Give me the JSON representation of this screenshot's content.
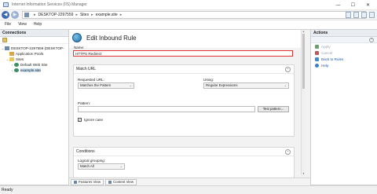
{
  "window": {
    "title": "Internet Information Services (IIS) Manager"
  },
  "address": {
    "crumbs": [
      "DESKTOP-2297559",
      "Sites",
      "example.site"
    ]
  },
  "menu": {
    "items": [
      "File",
      "View",
      "Help"
    ]
  },
  "connections": {
    "header": "Connections",
    "tree": [
      {
        "label": "DESKTOP-2297559 (DESKTOP-",
        "toggle": "⌄",
        "icon": "server"
      },
      {
        "label": "Application Pools",
        "toggle": "",
        "icon": "pool"
      },
      {
        "label": "Sites",
        "toggle": "⌄",
        "icon": "folder"
      },
      {
        "label": "Default Web Site",
        "toggle": "›",
        "icon": "globe"
      },
      {
        "label": "example.site",
        "toggle": "›",
        "icon": "globe"
      }
    ]
  },
  "main": {
    "title": "Edit Inbound Rule",
    "name_label": "Name:",
    "name_value": "HTTPS Redirect",
    "match_url": {
      "header": "Match URL",
      "requested_url_label": "Requested URL:",
      "requested_url_value": "Matches the Pattern",
      "using_label": "Using:",
      "using_value": "Regular Expressions",
      "pattern_label": "Pattern:",
      "pattern_value": "",
      "test_button": "Test pattern...",
      "ignore_case_label": "Ignore case",
      "ignore_case_checked": "✓"
    },
    "conditions": {
      "header": "Conditions",
      "logical_grouping_label": "Logical grouping:",
      "logical_grouping_value": "Match All"
    }
  },
  "view_tabs": {
    "features": "Features View",
    "content": "Content View"
  },
  "actions": {
    "header": "Actions",
    "items": [
      {
        "label": "Apply",
        "enabled": false
      },
      {
        "label": "Cancel",
        "enabled": false
      },
      {
        "label": "Back to Rules",
        "enabled": true
      },
      {
        "label": "Help",
        "enabled": true
      }
    ]
  },
  "status": {
    "text": "Ready"
  }
}
